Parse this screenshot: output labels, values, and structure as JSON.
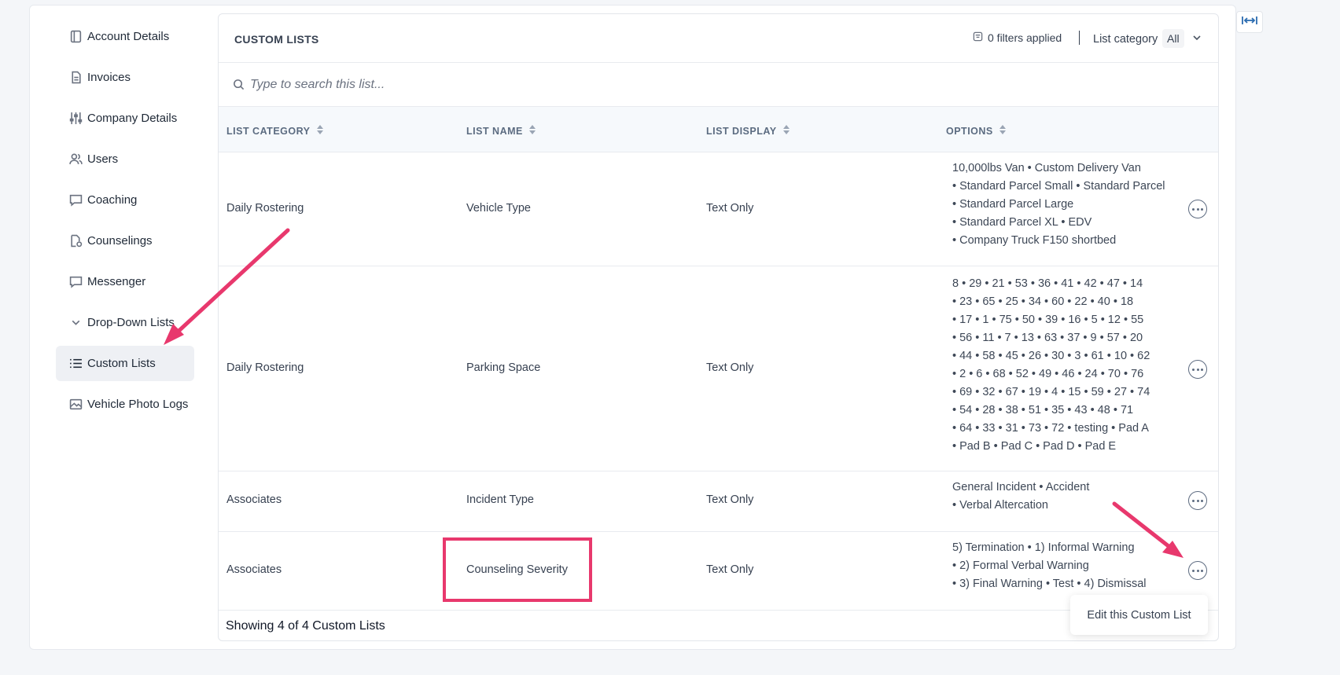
{
  "sidebar": {
    "items": [
      {
        "label": "Account Details",
        "icon": "sidebar-panel-icon"
      },
      {
        "label": "Invoices",
        "icon": "document-icon"
      },
      {
        "label": "Company Details",
        "icon": "sliders-icon"
      },
      {
        "label": "Users",
        "icon": "users-icon"
      },
      {
        "label": "Coaching",
        "icon": "chat-icon"
      },
      {
        "label": "Counselings",
        "icon": "document-badge-icon"
      },
      {
        "label": "Messenger",
        "icon": "chat-icon"
      },
      {
        "label": "Drop-Down Lists",
        "icon": "chevron-down-icon"
      },
      {
        "label": "Custom Lists",
        "icon": "list-icon",
        "active": true
      },
      {
        "label": "Vehicle Photo Logs",
        "icon": "image-icon"
      }
    ]
  },
  "card": {
    "title": "CUSTOM LISTS",
    "filters_text": "0 filters applied",
    "category_label": "List category",
    "category_value": "All"
  },
  "search": {
    "placeholder": "Type to search this list..."
  },
  "table": {
    "headers": [
      "LIST CATEGORY",
      "LIST NAME",
      "LIST DISPLAY",
      "OPTIONS"
    ],
    "rows": [
      {
        "category": "Daily Rostering",
        "name": "Vehicle Type",
        "display": "Text Only",
        "options": [
          "10,000lbs Van • Custom Delivery Van",
          "• Standard Parcel Small • Standard Parcel",
          "• Standard Parcel Large",
          "• Standard Parcel XL • EDV",
          "• Company Truck F150 shortbed"
        ]
      },
      {
        "category": "Daily Rostering",
        "name": "Parking Space",
        "display": "Text Only",
        "options": [
          "8 • 29 • 21 • 53 • 36 • 41 • 42 • 47 • 14",
          "• 23 • 65 • 25 • 34 • 60 • 22 • 40 • 18",
          "• 17 • 1 • 75 • 50 • 39 • 16 • 5 • 12 • 55",
          "• 56 • 11 • 7 • 13 • 63 • 37 • 9 • 57 • 20",
          "• 44 • 58 • 45 • 26 • 30 • 3 • 61 • 10 • 62",
          "• 2 • 6 • 68 • 52 • 49 • 46 • 24 • 70 • 76",
          "• 69 • 32 • 67 • 19 • 4 • 15 • 59 • 27 • 74",
          "• 54 • 28 • 38 • 51 • 35 • 43 • 48 • 71",
          "• 64 • 33 • 31 • 73 • 72 • testing • Pad A",
          "• Pad B • Pad C • Pad D • Pad E"
        ]
      },
      {
        "category": "Associates",
        "name": "Incident Type",
        "display": "Text Only",
        "options": [
          "General Incident • Accident",
          "• Verbal Altercation"
        ]
      },
      {
        "category": "Associates",
        "name": "Counseling Severity",
        "display": "Text Only",
        "options": [
          "5) Termination • 1) Informal Warning",
          "• 2) Formal Verbal Warning",
          "• 3) Final Warning • Test • 4) Dismissal"
        ]
      }
    ]
  },
  "footer": {
    "showing_text": "Showing 4 of 4 Custom Lists"
  },
  "popover": {
    "edit_label": "Edit this Custom List"
  },
  "colors": {
    "accent": "#2b6cb0",
    "annotation": "#e8386d",
    "active_bg": "#eef0f4"
  }
}
